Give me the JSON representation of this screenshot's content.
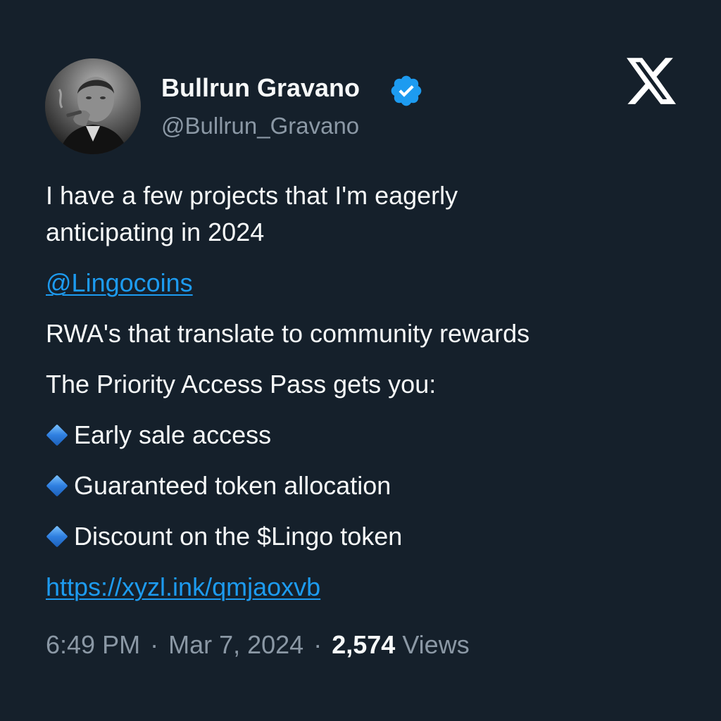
{
  "author": {
    "display_name": "Bullrun Gravano",
    "handle": "@Bullrun_Gravano",
    "verified": true,
    "verified_icon": "verified-badge-icon",
    "avatar_description_icon": "avatar-photo"
  },
  "brand": {
    "logo_icon": "x-logo-icon"
  },
  "tweet": {
    "line1": "I have a few projects that I'm eagerly",
    "line2": "anticipating in 2024",
    "mention": "@Lingocoins",
    "p2": "RWA's that translate to community rewards",
    "p3": "The Priority Access Pass gets you:",
    "bullets": [
      "Early sale access",
      "Guaranteed token allocation",
      "Discount on the $Lingo token"
    ],
    "bullet_icon": "blue-diamond-icon",
    "url": "https://xyzl.ink/qmjaoxvb"
  },
  "meta": {
    "time": "6:49 PM",
    "separator": "·",
    "date": "Mar 7, 2024",
    "views_count": "2,574",
    "views_label": "Views"
  },
  "colors": {
    "background": "#15202b",
    "text_primary": "#f7f9f9",
    "text_secondary": "#8b98a5",
    "link": "#1d9bf0",
    "verified": "#1d9bf0"
  }
}
